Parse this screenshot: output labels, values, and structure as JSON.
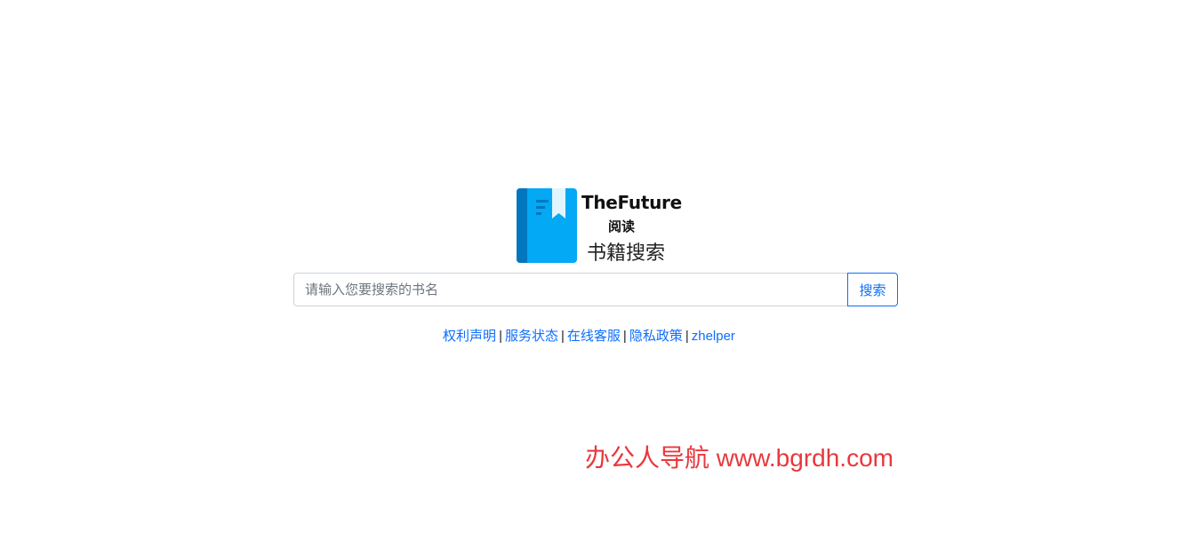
{
  "logo": {
    "title": "TheFuture",
    "subtitle": "阅读",
    "tagline": "书籍搜索",
    "colors": {
      "book_dark": "#0277bd",
      "book_light": "#03a9f4"
    }
  },
  "search": {
    "placeholder": "请输入您要搜索的书名",
    "value": "",
    "button_label": "搜索"
  },
  "footer_links": [
    {
      "label": "权利声明"
    },
    {
      "label": "服务状态"
    },
    {
      "label": "在线客服"
    },
    {
      "label": "隐私政策"
    },
    {
      "label": "zhelper"
    }
  ],
  "separator": "|",
  "watermark": "办公人导航 www.bgrdh.com",
  "colors": {
    "link": "#0d6efd",
    "watermark": "#e8383d"
  }
}
